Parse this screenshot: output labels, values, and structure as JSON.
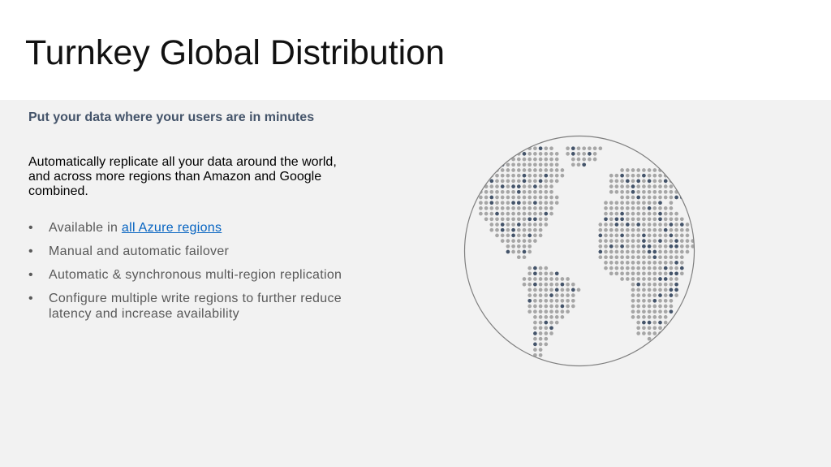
{
  "slide": {
    "title": "Turnkey Global Distribution",
    "subtitle": "Put your data where your users are in minutes",
    "intro": "Automatically replicate all your data around the world, and across more regions than Amazon and Google combined.",
    "bullets": [
      {
        "prefix": "Available in ",
        "link": "all Azure regions"
      },
      {
        "text": "Manual and automatic failover"
      },
      {
        "text": "Automatic & synchronous multi-region replication"
      },
      {
        "text": "Configure multiple write regions to further reduce latency and increase availability"
      }
    ],
    "bullet_glyph": "•"
  },
  "globe": {
    "icon": "world-map-dots-icon",
    "colors": {
      "land": "#a6a6a6",
      "region": "#44546a",
      "outline": "#7f7f7f"
    }
  }
}
